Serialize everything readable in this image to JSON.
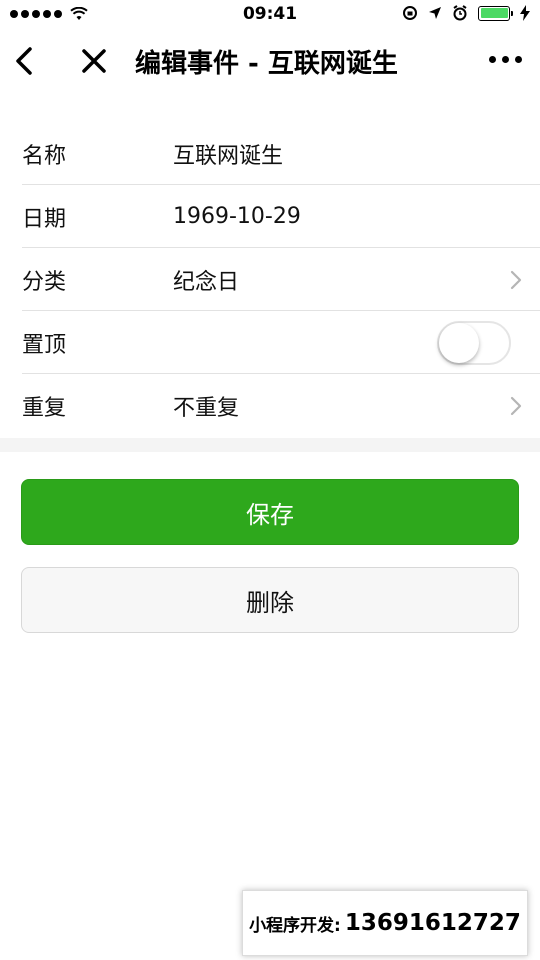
{
  "status_bar": {
    "time": "09:41",
    "signal_icon": "signal-dots-icon",
    "wifi_icon": "wifi-icon",
    "battery_color": "#4cd964"
  },
  "nav": {
    "title": "编辑事件 - 互联网诞生",
    "back_icon": "chevron-left-icon",
    "close_icon": "close-icon",
    "more_icon": "more-dots-icon"
  },
  "form": {
    "name": {
      "label": "名称",
      "value": "互联网诞生"
    },
    "date": {
      "label": "日期",
      "value": "1969-10-29"
    },
    "category": {
      "label": "分类",
      "value": "纪念日"
    },
    "pin": {
      "label": "置顶",
      "on": false
    },
    "repeat": {
      "label": "重复",
      "value": "不重复"
    }
  },
  "actions": {
    "save_label": "保存",
    "delete_label": "删除",
    "save_color": "#2ea81c"
  },
  "contact": {
    "label": "小程序开发:",
    "phone": "13691612727"
  }
}
